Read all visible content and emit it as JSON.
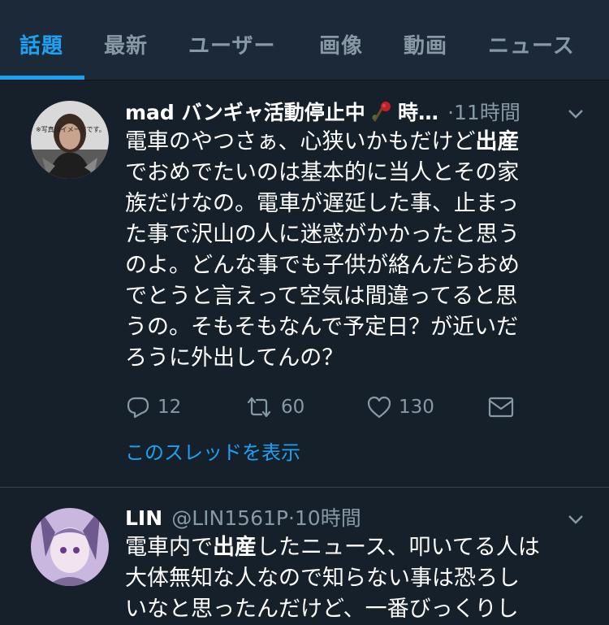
{
  "tabs": [
    {
      "label": "話題",
      "active": true
    },
    {
      "label": "最新",
      "active": false
    },
    {
      "label": "ユーザー",
      "active": false
    },
    {
      "label": "画像",
      "active": false
    },
    {
      "label": "動画",
      "active": false
    },
    {
      "label": "ニュース",
      "active": false
    }
  ],
  "colors": {
    "background": "#15202b",
    "tab_bar": "#1c2938",
    "accent": "#1da1f2",
    "secondary_text": "#8899a6",
    "divider": "#38444d"
  },
  "tweets": [
    {
      "name": "mad バンギャ活動停止中",
      "name_suffix": "時…",
      "handle": "",
      "time": "·11時間",
      "avatar_text": "※写真はイメージです。",
      "text_lines": [
        [
          "電車のやつさぁ、心狭いかもだけど",
          "出産"
        ],
        [
          "でおめでたいのは基本的に当人とその家"
        ],
        [
          "族だけなの。電車が遅延した事、止まっ"
        ],
        [
          "た事で沢山の人に迷惑がかかったと思う"
        ],
        [
          "のよ。どんな事でも子供が絡んだらおめ"
        ],
        [
          "でとうと言えって空気は間違ってると思"
        ],
        [
          "うの。そもそもなんで予定日？が近いだ"
        ],
        [
          "ろうに外出してんの？"
        ]
      ],
      "replies": "12",
      "retweets": "60",
      "likes": "130",
      "thread_link": "このスレッドを表示"
    },
    {
      "name": "LIN",
      "handle": "@LIN1561P",
      "time": "·10時間",
      "text_lines": [
        [
          "電車内で",
          "出産",
          "したニュース、叩いてる人は"
        ],
        [
          "大体無知な人なので知らない事は恐ろし"
        ],
        [
          "いなと思ったんだけど、一番びっくりし"
        ]
      ]
    }
  ]
}
